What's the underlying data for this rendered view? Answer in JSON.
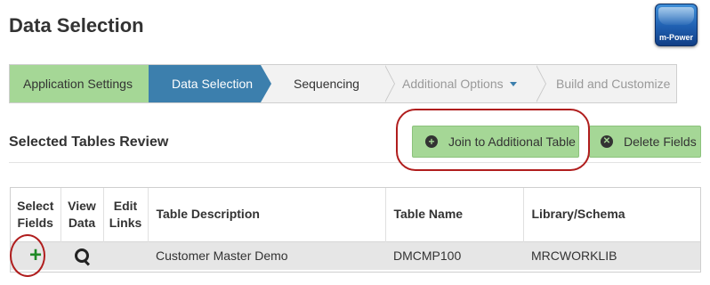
{
  "header": {
    "title": "Data Selection",
    "logo_text": "m-Power"
  },
  "wizard": {
    "steps": [
      {
        "label": "Application Settings",
        "state": "completed"
      },
      {
        "label": "Data Selection",
        "state": "active"
      },
      {
        "label": "Sequencing",
        "state": "available"
      },
      {
        "label": "Additional Options",
        "state": "disabled",
        "has_dropdown": true
      },
      {
        "label": "Build and Customize",
        "state": "disabled"
      }
    ]
  },
  "section": {
    "title": "Selected Tables Review",
    "join_button": "Join to Additional Table",
    "delete_button": "Delete Fields"
  },
  "table": {
    "headers": {
      "select": [
        "Select",
        "Fields"
      ],
      "view": [
        "View",
        "Data"
      ],
      "edit": [
        "Edit",
        "Links"
      ],
      "description": "Table Description",
      "name": "Table Name",
      "library": "Library/Schema"
    },
    "rows": [
      {
        "select_icon": "plus-icon",
        "view_icon": "search-icon",
        "description": "Customer Master Demo",
        "name": "DMCMP100",
        "library": "MRCWORKLIB"
      }
    ]
  },
  "colors": {
    "completed_step": "#a5d796",
    "active_step": "#3c7fad",
    "button_bg": "#a5d796",
    "highlight_ring": "#b01d1d",
    "add_icon": "#1f8a26"
  }
}
